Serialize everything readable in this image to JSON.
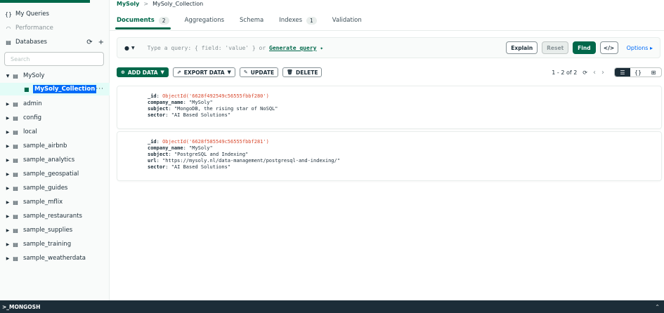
{
  "sidebar": {
    "my_queries": "My Queries",
    "performance": "Performance",
    "databases": "Databases",
    "search_placeholder": "Search",
    "active_db": "MySoly",
    "active_collection": "MySoly_Collection",
    "databases_list": [
      "admin",
      "config",
      "local",
      "sample_airbnb",
      "sample_analytics",
      "sample_geospatial",
      "sample_guides",
      "sample_mflix",
      "sample_restaurants",
      "sample_supplies",
      "sample_training",
      "sample_weatherdata"
    ]
  },
  "breadcrumb": {
    "db": "MySoly",
    "sep": ">",
    "collection": "MySoly_Collection"
  },
  "tabs": [
    {
      "label": "Documents",
      "count": "2"
    },
    {
      "label": "Aggregations"
    },
    {
      "label": "Schema"
    },
    {
      "label": "Indexes",
      "count": "1"
    },
    {
      "label": "Validation"
    }
  ],
  "query": {
    "placeholder_prefix": "Type a query: { field: 'value' } or",
    "generate": "Generate query",
    "explain": "Explain",
    "reset": "Reset",
    "find": "Find",
    "code": "</>",
    "options": "Options ▸"
  },
  "toolbar": {
    "add_data": "ADD DATA",
    "export_data": "EXPORT DATA",
    "update": "UPDATE",
    "delete": "DELETE",
    "pagination": "1 - 2 of 2"
  },
  "documents": [
    {
      "fields": [
        {
          "key": "_id",
          "value": "ObjectId('6628f492549c56555fbbf280')",
          "oid": true
        },
        {
          "key": "company_name",
          "value": "\"MySoly\""
        },
        {
          "key": "subject",
          "value": "\"MongoDB, the rising star of NoSQL\""
        },
        {
          "key": "sector",
          "value": "\"AI Based Solutions\""
        }
      ]
    },
    {
      "fields": [
        {
          "key": "_id",
          "value": "ObjectId('6628f585549c56555fbbf281')",
          "oid": true
        },
        {
          "key": "company_name",
          "value": "\"MySoly\""
        },
        {
          "key": "subject",
          "value": "\"PostgreSQL and Indexing\""
        },
        {
          "key": "url",
          "value": "\"https://mysoly.nl/data-management/postgresql-and-indexing/\""
        },
        {
          "key": "sector",
          "value": "\"AI Based Solutions\""
        }
      ]
    }
  ],
  "mongosh": {
    "label": ">_MONGOSH"
  }
}
